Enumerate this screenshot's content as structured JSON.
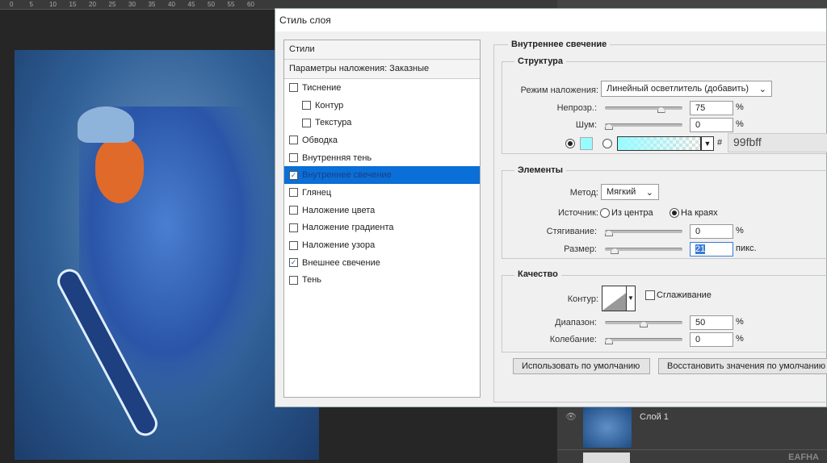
{
  "ruler": {
    "ticks": [
      "0",
      "5",
      "10",
      "15",
      "20",
      "25",
      "30",
      "35",
      "40",
      "45",
      "50",
      "55",
      "60"
    ]
  },
  "dialog": {
    "title": "Стиль слоя",
    "styles_header": "Стили",
    "blending_options": "Параметры наложения: Заказные",
    "styles": [
      {
        "label": "Тиснение",
        "checked": false,
        "indent": false
      },
      {
        "label": "Контур",
        "checked": false,
        "indent": true
      },
      {
        "label": "Текстура",
        "checked": false,
        "indent": true
      },
      {
        "label": "Обводка",
        "checked": false,
        "indent": false
      },
      {
        "label": "Внутренняя тень",
        "checked": false,
        "indent": false
      },
      {
        "label": "Внутреннее свечение",
        "checked": true,
        "indent": false,
        "selected": true
      },
      {
        "label": "Глянец",
        "checked": false,
        "indent": false
      },
      {
        "label": "Наложение цвета",
        "checked": false,
        "indent": false
      },
      {
        "label": "Наложение градиента",
        "checked": false,
        "indent": false
      },
      {
        "label": "Наложение узора",
        "checked": false,
        "indent": false
      },
      {
        "label": "Внешнее свечение",
        "checked": true,
        "indent": false
      },
      {
        "label": "Тень",
        "checked": false,
        "indent": false
      }
    ],
    "panel_title": "Внутреннее свечение",
    "structure": {
      "title": "Структура",
      "blend_mode_label": "Режим наложения:",
      "blend_mode": "Линейный осветлитель (добавить)",
      "opacity_label": "Непрозр.:",
      "opacity": "75",
      "opacity_value": 75,
      "noise_label": "Шум:",
      "noise": "0",
      "noise_value": 0,
      "percent": "%",
      "hash": "#",
      "color_hex": "99fbff",
      "color": "#99fbff"
    },
    "elements": {
      "title": "Элементы",
      "method_label": "Метод:",
      "method": "Мягкий",
      "source_label": "Источник:",
      "source_center": "Из центра",
      "source_edge": "На краях",
      "choke_label": "Стягивание:",
      "choke": "0",
      "choke_value": 0,
      "size_label": "Размер:",
      "size": "21",
      "size_value": 21,
      "size_unit": "пикс."
    },
    "quality": {
      "title": "Качество",
      "contour_label": "Контур:",
      "antialias_label": "Сглаживание",
      "range_label": "Диапазон:",
      "range": "50",
      "range_value": 50,
      "jitter_label": "Колебание:",
      "jitter": "0",
      "jitter_value": 0
    },
    "make_default": "Использовать по умолчанию",
    "reset_default": "Восстановить значения по умолчанию"
  },
  "layers": {
    "layer_name": "Слой 1",
    "watermark": "EAFHA"
  }
}
